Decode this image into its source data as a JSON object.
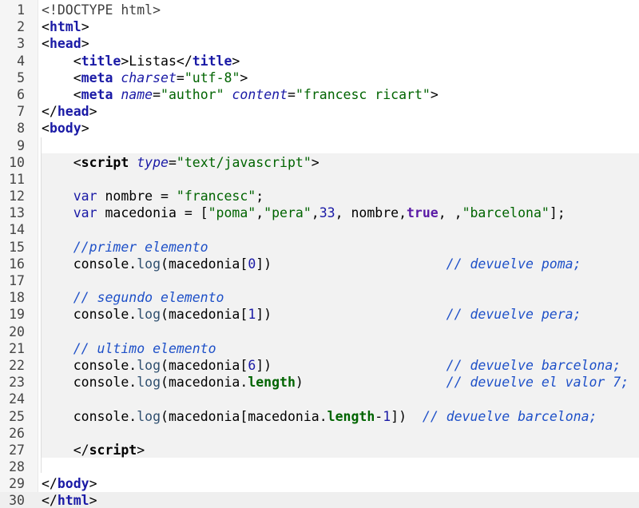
{
  "editor": {
    "current_line": 30,
    "lines": [
      {
        "n": "1",
        "tokens": [
          {
            "t": "<!DOCTYPE html>",
            "c": "t-decl"
          }
        ]
      },
      {
        "n": "2",
        "tokens": [
          {
            "t": "<",
            "c": "t-punct"
          },
          {
            "t": "html",
            "c": "t-tag"
          },
          {
            "t": ">",
            "c": "t-punct"
          }
        ]
      },
      {
        "n": "3",
        "tokens": [
          {
            "t": "<",
            "c": "t-punct"
          },
          {
            "t": "head",
            "c": "t-tag"
          },
          {
            "t": ">",
            "c": "t-punct"
          }
        ]
      },
      {
        "n": "4",
        "tokens": [
          {
            "t": "    <",
            "c": "t-punct"
          },
          {
            "t": "title",
            "c": "t-tag"
          },
          {
            "t": ">Listas</",
            "c": "t-punct"
          },
          {
            "t": "title",
            "c": "t-tag"
          },
          {
            "t": ">",
            "c": "t-punct"
          }
        ]
      },
      {
        "n": "5",
        "tokens": [
          {
            "t": "    <",
            "c": "t-punct"
          },
          {
            "t": "meta",
            "c": "t-tag"
          },
          {
            "t": " ",
            "c": "t-plain"
          },
          {
            "t": "charset",
            "c": "t-attr"
          },
          {
            "t": "=",
            "c": "t-punct"
          },
          {
            "t": "\"utf-8\"",
            "c": "t-str"
          },
          {
            "t": ">",
            "c": "t-punct"
          }
        ]
      },
      {
        "n": "6",
        "tokens": [
          {
            "t": "    <",
            "c": "t-punct"
          },
          {
            "t": "meta",
            "c": "t-tag"
          },
          {
            "t": " ",
            "c": "t-plain"
          },
          {
            "t": "name",
            "c": "t-attr"
          },
          {
            "t": "=",
            "c": "t-punct"
          },
          {
            "t": "\"author\"",
            "c": "t-str"
          },
          {
            "t": " ",
            "c": "t-plain"
          },
          {
            "t": "content",
            "c": "t-attr"
          },
          {
            "t": "=",
            "c": "t-punct"
          },
          {
            "t": "\"francesc ricart\"",
            "c": "t-str"
          },
          {
            "t": ">",
            "c": "t-punct"
          }
        ]
      },
      {
        "n": "7",
        "tokens": [
          {
            "t": "</",
            "c": "t-punct"
          },
          {
            "t": "head",
            "c": "t-tag"
          },
          {
            "t": ">",
            "c": "t-punct"
          }
        ]
      },
      {
        "n": "8",
        "tokens": [
          {
            "t": "<",
            "c": "t-punct"
          },
          {
            "t": "body",
            "c": "t-tag"
          },
          {
            "t": ">",
            "c": "t-punct"
          }
        ]
      },
      {
        "n": "9",
        "tokens": []
      },
      {
        "n": "10",
        "tokens": [
          {
            "t": "    <",
            "c": "t-punct"
          },
          {
            "t": "script",
            "c": "t-script-tag"
          },
          {
            "t": " ",
            "c": "t-plain"
          },
          {
            "t": "type",
            "c": "t-attr"
          },
          {
            "t": "=",
            "c": "t-punct"
          },
          {
            "t": "\"text/javascript\"",
            "c": "t-str"
          },
          {
            "t": ">",
            "c": "t-punct"
          }
        ]
      },
      {
        "n": "11",
        "tokens": []
      },
      {
        "n": "12",
        "tokens": [
          {
            "t": "    var",
            "c": "t-keyword"
          },
          {
            "t": " nombre = ",
            "c": "t-plain"
          },
          {
            "t": "\"francesc\"",
            "c": "t-str"
          },
          {
            "t": ";",
            "c": "t-plain"
          }
        ]
      },
      {
        "n": "13",
        "tokens": [
          {
            "t": "    var",
            "c": "t-keyword"
          },
          {
            "t": " macedonia = [",
            "c": "t-plain"
          },
          {
            "t": "\"poma\"",
            "c": "t-str"
          },
          {
            "t": ",",
            "c": "t-plain"
          },
          {
            "t": "\"pera\"",
            "c": "t-str"
          },
          {
            "t": ",",
            "c": "t-plain"
          },
          {
            "t": "33",
            "c": "t-num"
          },
          {
            "t": ", nombre,",
            "c": "t-plain"
          },
          {
            "t": "true",
            "c": "t-bool"
          },
          {
            "t": ", ,",
            "c": "t-plain"
          },
          {
            "t": "\"barcelona\"",
            "c": "t-str"
          },
          {
            "t": "];",
            "c": "t-plain"
          }
        ]
      },
      {
        "n": "14",
        "tokens": []
      },
      {
        "n": "15",
        "tokens": [
          {
            "t": "    //primer elemento",
            "c": "t-comment"
          }
        ]
      },
      {
        "n": "16",
        "tokens": [
          {
            "t": "    console.",
            "c": "t-plain"
          },
          {
            "t": "log",
            "c": "t-method"
          },
          {
            "t": "(macedonia[",
            "c": "t-plain"
          },
          {
            "t": "0",
            "c": "t-num"
          },
          {
            "t": "])                      ",
            "c": "t-plain"
          },
          {
            "t": "// devuelve poma;",
            "c": "t-comment"
          }
        ]
      },
      {
        "n": "17",
        "tokens": []
      },
      {
        "n": "18",
        "tokens": [
          {
            "t": "    // segundo elemento",
            "c": "t-comment"
          }
        ]
      },
      {
        "n": "19",
        "tokens": [
          {
            "t": "    console.",
            "c": "t-plain"
          },
          {
            "t": "log",
            "c": "t-method"
          },
          {
            "t": "(macedonia[",
            "c": "t-plain"
          },
          {
            "t": "1",
            "c": "t-num"
          },
          {
            "t": "])                      ",
            "c": "t-plain"
          },
          {
            "t": "// devuelve pera;",
            "c": "t-comment"
          }
        ]
      },
      {
        "n": "20",
        "tokens": []
      },
      {
        "n": "21",
        "tokens": [
          {
            "t": "    // ultimo elemento",
            "c": "t-comment"
          }
        ]
      },
      {
        "n": "22",
        "tokens": [
          {
            "t": "    console.",
            "c": "t-plain"
          },
          {
            "t": "log",
            "c": "t-method"
          },
          {
            "t": "(macedonia[",
            "c": "t-plain"
          },
          {
            "t": "6",
            "c": "t-num"
          },
          {
            "t": "])                      ",
            "c": "t-plain"
          },
          {
            "t": "// devuelve barcelona;",
            "c": "t-comment"
          }
        ]
      },
      {
        "n": "23",
        "tokens": [
          {
            "t": "    console.",
            "c": "t-plain"
          },
          {
            "t": "log",
            "c": "t-method"
          },
          {
            "t": "(macedonia.",
            "c": "t-plain"
          },
          {
            "t": "length",
            "c": "t-prop"
          },
          {
            "t": ")                  ",
            "c": "t-plain"
          },
          {
            "t": "// devuelve el valor 7;",
            "c": "t-comment"
          }
        ]
      },
      {
        "n": "24",
        "tokens": []
      },
      {
        "n": "25",
        "tokens": [
          {
            "t": "    console.",
            "c": "t-plain"
          },
          {
            "t": "log",
            "c": "t-method"
          },
          {
            "t": "(macedonia[macedonia.",
            "c": "t-plain"
          },
          {
            "t": "length",
            "c": "t-prop"
          },
          {
            "t": "-",
            "c": "t-plain"
          },
          {
            "t": "1",
            "c": "t-num"
          },
          {
            "t": "])  ",
            "c": "t-plain"
          },
          {
            "t": "// devuelve barcelona;",
            "c": "t-comment"
          }
        ]
      },
      {
        "n": "26",
        "tokens": []
      },
      {
        "n": "27",
        "tokens": [
          {
            "t": "    </",
            "c": "t-punct"
          },
          {
            "t": "script",
            "c": "t-script-tag"
          },
          {
            "t": ">",
            "c": "t-punct"
          }
        ]
      },
      {
        "n": "28",
        "tokens": []
      },
      {
        "n": "29",
        "tokens": [
          {
            "t": "</",
            "c": "t-punct"
          },
          {
            "t": "body",
            "c": "t-tag"
          },
          {
            "t": ">",
            "c": "t-punct"
          }
        ]
      },
      {
        "n": "30",
        "tokens": [
          {
            "t": "</",
            "c": "t-punct"
          },
          {
            "t": "html",
            "c": "t-tag"
          },
          {
            "t": ">",
            "c": "t-punct"
          }
        ]
      }
    ]
  }
}
